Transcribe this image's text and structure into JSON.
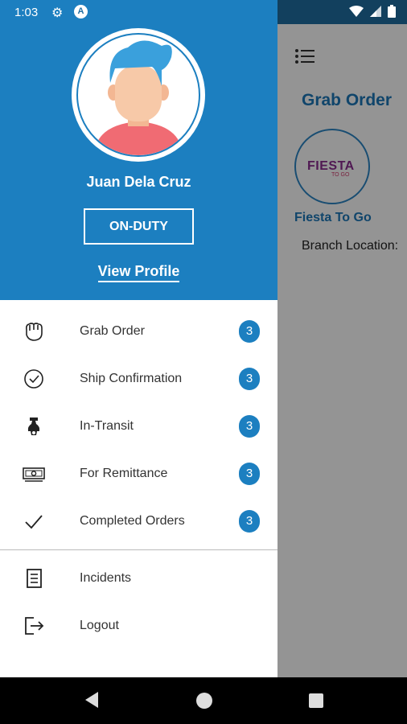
{
  "status_bar": {
    "time": "1:03"
  },
  "background_screen": {
    "title": "Grab Order",
    "merchant_logo_text": "FIESTA",
    "merchant_logo_sub": "TO GO",
    "merchant_name": "Fiesta To Go",
    "branch_label": "Branch Location:"
  },
  "drawer": {
    "user_name": "Juan Dela Cruz",
    "duty_button": "ON-DUTY",
    "view_profile": "View Profile",
    "menu": [
      {
        "label": "Grab Order",
        "badge": "3",
        "icon": "hand-icon"
      },
      {
        "label": "Ship Confirmation",
        "badge": "3",
        "icon": "check-circle-icon"
      },
      {
        "label": "In-Transit",
        "badge": "3",
        "icon": "scooter-icon"
      },
      {
        "label": "For Remittance",
        "badge": "3",
        "icon": "money-icon"
      },
      {
        "label": "Completed Orders",
        "badge": "3",
        "icon": "checkmark-icon"
      }
    ],
    "secondary_menu": [
      {
        "label": "Incidents",
        "icon": "document-icon"
      },
      {
        "label": "Logout",
        "icon": "logout-icon"
      }
    ]
  },
  "colors": {
    "primary": "#1c7fc0",
    "avatar_hair": "#3aa0dc",
    "avatar_shirt": "#f06b73",
    "avatar_skin": "#f7c9a8"
  }
}
